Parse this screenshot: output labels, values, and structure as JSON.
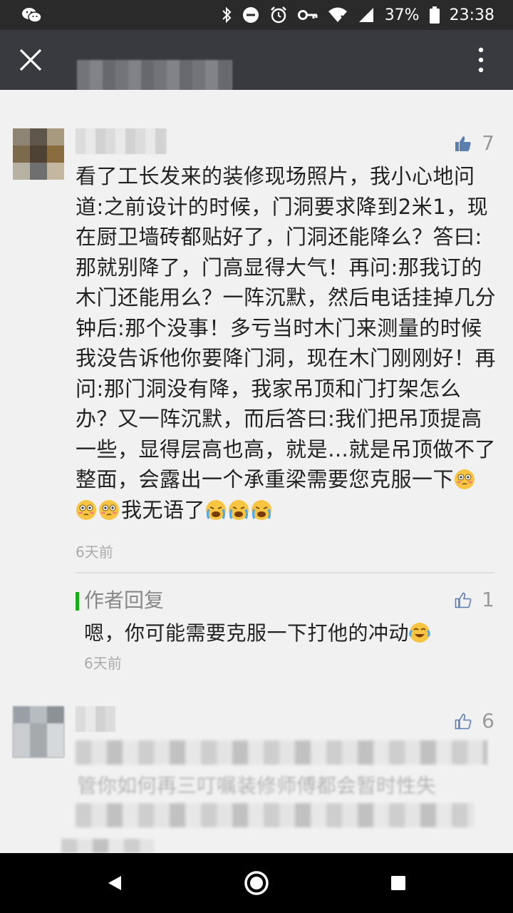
{
  "status_bar": {
    "battery": "37%",
    "time": "23:38"
  },
  "comments": [
    {
      "likes": "7",
      "text": "看了工长发来的装修现场照片，我小心地问道:之前设计的时候，门洞要求降到2米1，现在厨卫墙砖都贴好了，门洞还能降么？答曰:那就别降了，门高显得大气！再问:那我订的木门还能用么？一阵沉默，然后电话挂掉几分钟后:那个没事！多亏当时木门来测量的时候我没告诉他你要降门洞，现在木门刚刚好！再问:那门洞没有降，我家吊顶和门打架怎么办？又一阵沉默，而后答曰:我们把吊顶提高一些，显得层高也高，就是…就是吊顶做不了整面，会露出一个承重梁需要您克服一下",
      "text_after_emoji": "我无语了",
      "time": "6天前",
      "reply": {
        "label": "作者回复",
        "likes": "1",
        "text": "嗯，你可能需要克服一下打他的冲动",
        "time": "6天前"
      }
    },
    {
      "likes": "6",
      "partial_text": "管你如何再三叮嘱装修师傅都会暂时性失"
    }
  ],
  "icons": {
    "status_left": "wechat-icon",
    "close": "close-icon",
    "more": "more-vertical-icon",
    "like": "thumbs-up-icon",
    "back": "back-icon",
    "home": "home-icon",
    "recents": "recents-icon"
  },
  "colors": {
    "accent": "#1aad19",
    "like": "#5b7fb1",
    "navbar": "#393a3f"
  }
}
